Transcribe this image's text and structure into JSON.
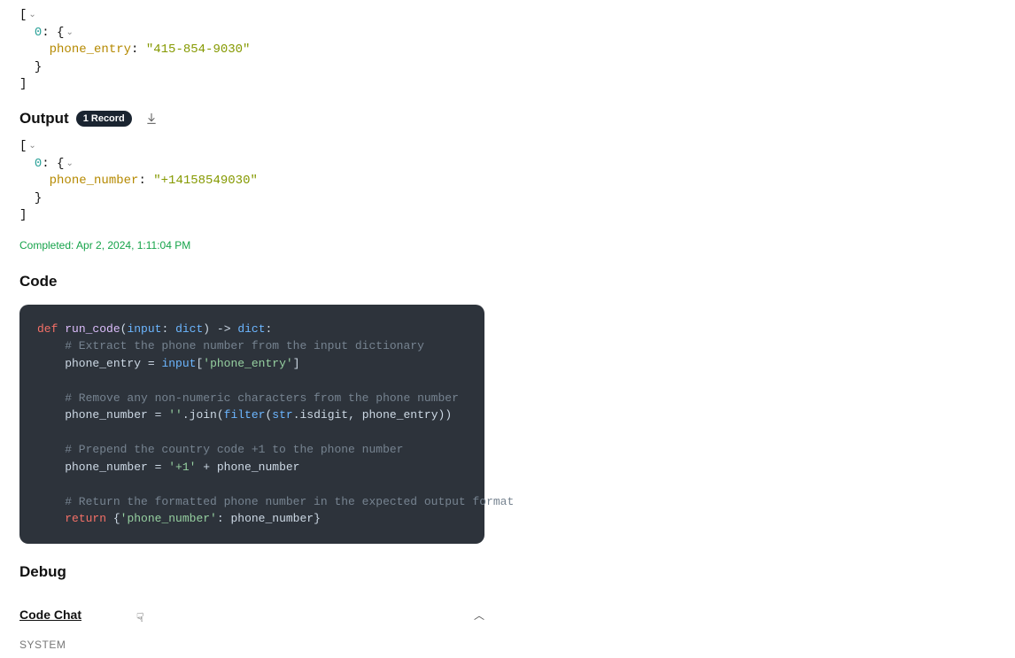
{
  "input_json": {
    "index": "0",
    "key": "phone_entry",
    "value": "\"415-854-9030\""
  },
  "output_section": {
    "title": "Output",
    "badge": "1 Record"
  },
  "output_json": {
    "index": "0",
    "key": "phone_number",
    "value": "\"+14158549030\""
  },
  "status_text": "Completed: Apr 2, 2024, 1:11:04 PM",
  "code_section": {
    "title": "Code"
  },
  "code": {
    "l1_def": "def",
    "l1_fn": "run_code",
    "l1_open": "(",
    "l1_input": "input",
    "l1_colon1": ": ",
    "l1_dict1": "dict",
    "l1_close": ")",
    "l1_arrow": " -> ",
    "l1_dict2": "dict",
    "l1_end": ":",
    "l2": "    # Extract the phone number from the input dictionary",
    "l3_a": "    phone_entry = ",
    "l3_b": "input",
    "l3_c": "[",
    "l3_d": "'phone_entry'",
    "l3_e": "]",
    "l5": "    # Remove any non-numeric characters from the phone number",
    "l6_a": "    phone_number = ",
    "l6_b": "''",
    "l6_c": ".join(",
    "l6_d": "filter",
    "l6_e": "(",
    "l6_f": "str",
    "l6_g": ".isdigit, phone_entry))",
    "l8": "    # Prepend the country code +1 to the phone number",
    "l9_a": "    phone_number = ",
    "l9_b": "'+1'",
    "l9_c": " + phone_number",
    "l11": "    # Return the formatted phone number in the expected output format",
    "l12_a": "    ",
    "l12_b": "return",
    "l12_c": " {",
    "l12_d": "'phone_number'",
    "l12_e": ": phone_number}"
  },
  "debug_title": "Debug",
  "chat_title": "Code Chat",
  "system_label": "SYSTEM"
}
